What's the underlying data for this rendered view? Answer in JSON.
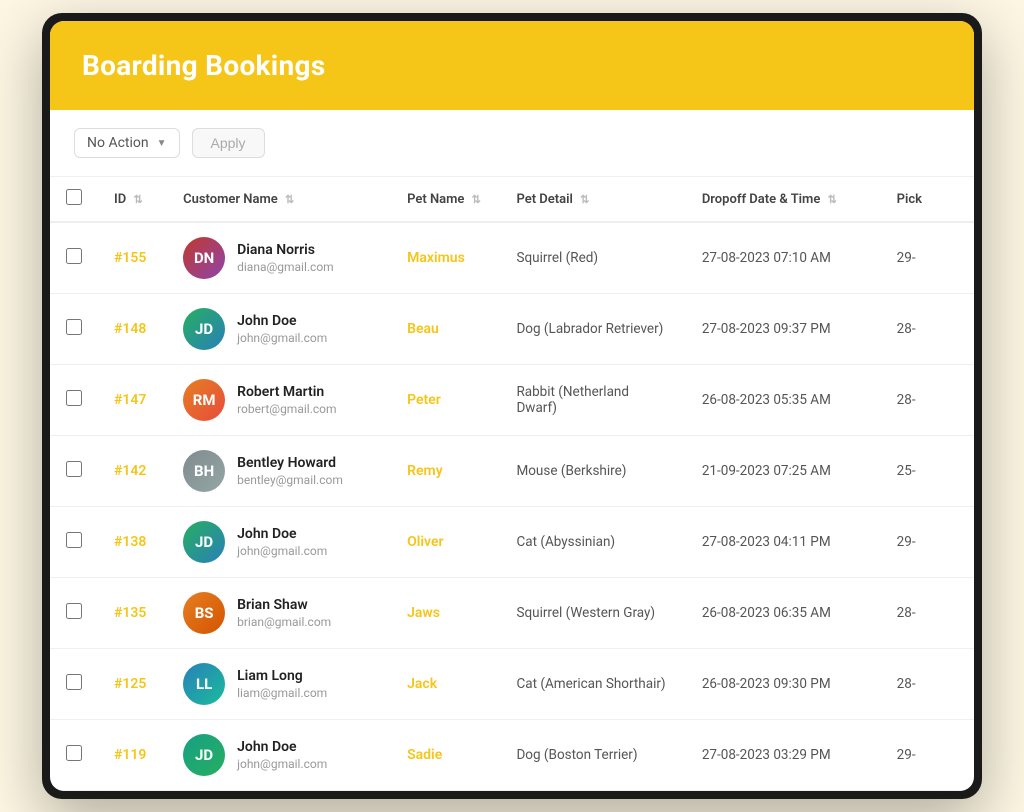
{
  "header": {
    "title": "Boarding Bookings"
  },
  "toolbar": {
    "action_label": "No Action",
    "apply_label": "Apply"
  },
  "table": {
    "columns": [
      {
        "key": "checkbox",
        "label": ""
      },
      {
        "key": "id",
        "label": "ID"
      },
      {
        "key": "customer",
        "label": "Customer Name"
      },
      {
        "key": "pet_name",
        "label": "Pet Name"
      },
      {
        "key": "pet_detail",
        "label": "Pet Detail"
      },
      {
        "key": "dropoff",
        "label": "Dropoff Date & Time"
      },
      {
        "key": "pickup",
        "label": "Pick"
      }
    ],
    "rows": [
      {
        "id": "#155",
        "avatar_class": "avatar-155",
        "avatar_initials": "DN",
        "customer_name": "Diana Norris",
        "customer_email": "diana@gmail.com",
        "pet_name": "Maximus",
        "pet_detail": "Squirrel (Red)",
        "dropoff": "27-08-2023 07:10 AM",
        "pickup": "29-"
      },
      {
        "id": "#148",
        "avatar_class": "avatar-148",
        "avatar_initials": "JD",
        "customer_name": "John Doe",
        "customer_email": "john@gmail.com",
        "pet_name": "Beau",
        "pet_detail": "Dog (Labrador Retriever)",
        "dropoff": "27-08-2023 09:37 PM",
        "pickup": "28-"
      },
      {
        "id": "#147",
        "avatar_class": "avatar-147",
        "avatar_initials": "RM",
        "customer_name": "Robert Martin",
        "customer_email": "robert@gmail.com",
        "pet_name": "Peter",
        "pet_detail": "Rabbit (Netherland Dwarf)",
        "dropoff": "26-08-2023 05:35 AM",
        "pickup": "28-"
      },
      {
        "id": "#142",
        "avatar_class": "avatar-142",
        "avatar_initials": "BH",
        "customer_name": "Bentley Howard",
        "customer_email": "bentley@gmail.com",
        "pet_name": "Remy",
        "pet_detail": "Mouse (Berkshire)",
        "dropoff": "21-09-2023 07:25 AM",
        "pickup": "25-"
      },
      {
        "id": "#138",
        "avatar_class": "avatar-138",
        "avatar_initials": "JD",
        "customer_name": "John Doe",
        "customer_email": "john@gmail.com",
        "pet_name": "Oliver",
        "pet_detail": "Cat (Abyssinian)",
        "dropoff": "27-08-2023 04:11 PM",
        "pickup": "29-"
      },
      {
        "id": "#135",
        "avatar_class": "avatar-135",
        "avatar_initials": "BS",
        "customer_name": "Brian Shaw",
        "customer_email": "brian@gmail.com",
        "pet_name": "Jaws",
        "pet_detail": "Squirrel (Western Gray)",
        "dropoff": "26-08-2023 06:35 AM",
        "pickup": "28-"
      },
      {
        "id": "#125",
        "avatar_class": "avatar-125",
        "avatar_initials": "LL",
        "customer_name": "Liam Long",
        "customer_email": "liam@gmail.com",
        "pet_name": "Jack",
        "pet_detail": "Cat (American Shorthair)",
        "dropoff": "26-08-2023 09:30 PM",
        "pickup": "28-"
      },
      {
        "id": "#119",
        "avatar_class": "avatar-119",
        "avatar_initials": "JD",
        "customer_name": "John Doe",
        "customer_email": "john@gmail.com",
        "pet_name": "Sadie",
        "pet_detail": "Dog (Boston Terrier)",
        "dropoff": "27-08-2023 03:29 PM",
        "pickup": "29-"
      }
    ]
  }
}
